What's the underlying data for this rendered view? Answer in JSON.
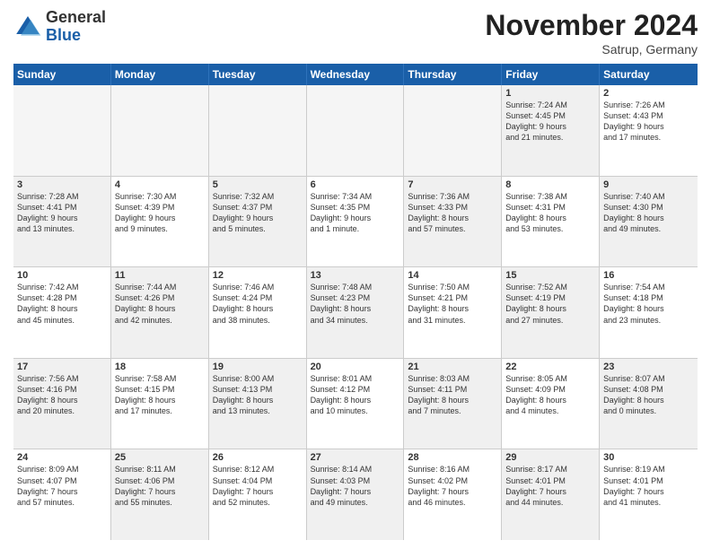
{
  "header": {
    "logo_general": "General",
    "logo_blue": "Blue",
    "month_title": "November 2024",
    "location": "Satrup, Germany"
  },
  "weekdays": [
    "Sunday",
    "Monday",
    "Tuesday",
    "Wednesday",
    "Thursday",
    "Friday",
    "Saturday"
  ],
  "rows": [
    [
      {
        "day": "",
        "info": "",
        "empty": true
      },
      {
        "day": "",
        "info": "",
        "empty": true
      },
      {
        "day": "",
        "info": "",
        "empty": true
      },
      {
        "day": "",
        "info": "",
        "empty": true
      },
      {
        "day": "",
        "info": "",
        "empty": true
      },
      {
        "day": "1",
        "info": "Sunrise: 7:24 AM\nSunset: 4:45 PM\nDaylight: 9 hours\nand 21 minutes.",
        "empty": false,
        "shaded": true
      },
      {
        "day": "2",
        "info": "Sunrise: 7:26 AM\nSunset: 4:43 PM\nDaylight: 9 hours\nand 17 minutes.",
        "empty": false,
        "shaded": false
      }
    ],
    [
      {
        "day": "3",
        "info": "Sunrise: 7:28 AM\nSunset: 4:41 PM\nDaylight: 9 hours\nand 13 minutes.",
        "empty": false,
        "shaded": true
      },
      {
        "day": "4",
        "info": "Sunrise: 7:30 AM\nSunset: 4:39 PM\nDaylight: 9 hours\nand 9 minutes.",
        "empty": false,
        "shaded": false
      },
      {
        "day": "5",
        "info": "Sunrise: 7:32 AM\nSunset: 4:37 PM\nDaylight: 9 hours\nand 5 minutes.",
        "empty": false,
        "shaded": true
      },
      {
        "day": "6",
        "info": "Sunrise: 7:34 AM\nSunset: 4:35 PM\nDaylight: 9 hours\nand 1 minute.",
        "empty": false,
        "shaded": false
      },
      {
        "day": "7",
        "info": "Sunrise: 7:36 AM\nSunset: 4:33 PM\nDaylight: 8 hours\nand 57 minutes.",
        "empty": false,
        "shaded": true
      },
      {
        "day": "8",
        "info": "Sunrise: 7:38 AM\nSunset: 4:31 PM\nDaylight: 8 hours\nand 53 minutes.",
        "empty": false,
        "shaded": false
      },
      {
        "day": "9",
        "info": "Sunrise: 7:40 AM\nSunset: 4:30 PM\nDaylight: 8 hours\nand 49 minutes.",
        "empty": false,
        "shaded": true
      }
    ],
    [
      {
        "day": "10",
        "info": "Sunrise: 7:42 AM\nSunset: 4:28 PM\nDaylight: 8 hours\nand 45 minutes.",
        "empty": false,
        "shaded": false
      },
      {
        "day": "11",
        "info": "Sunrise: 7:44 AM\nSunset: 4:26 PM\nDaylight: 8 hours\nand 42 minutes.",
        "empty": false,
        "shaded": true
      },
      {
        "day": "12",
        "info": "Sunrise: 7:46 AM\nSunset: 4:24 PM\nDaylight: 8 hours\nand 38 minutes.",
        "empty": false,
        "shaded": false
      },
      {
        "day": "13",
        "info": "Sunrise: 7:48 AM\nSunset: 4:23 PM\nDaylight: 8 hours\nand 34 minutes.",
        "empty": false,
        "shaded": true
      },
      {
        "day": "14",
        "info": "Sunrise: 7:50 AM\nSunset: 4:21 PM\nDaylight: 8 hours\nand 31 minutes.",
        "empty": false,
        "shaded": false
      },
      {
        "day": "15",
        "info": "Sunrise: 7:52 AM\nSunset: 4:19 PM\nDaylight: 8 hours\nand 27 minutes.",
        "empty": false,
        "shaded": true
      },
      {
        "day": "16",
        "info": "Sunrise: 7:54 AM\nSunset: 4:18 PM\nDaylight: 8 hours\nand 23 minutes.",
        "empty": false,
        "shaded": false
      }
    ],
    [
      {
        "day": "17",
        "info": "Sunrise: 7:56 AM\nSunset: 4:16 PM\nDaylight: 8 hours\nand 20 minutes.",
        "empty": false,
        "shaded": true
      },
      {
        "day": "18",
        "info": "Sunrise: 7:58 AM\nSunset: 4:15 PM\nDaylight: 8 hours\nand 17 minutes.",
        "empty": false,
        "shaded": false
      },
      {
        "day": "19",
        "info": "Sunrise: 8:00 AM\nSunset: 4:13 PM\nDaylight: 8 hours\nand 13 minutes.",
        "empty": false,
        "shaded": true
      },
      {
        "day": "20",
        "info": "Sunrise: 8:01 AM\nSunset: 4:12 PM\nDaylight: 8 hours\nand 10 minutes.",
        "empty": false,
        "shaded": false
      },
      {
        "day": "21",
        "info": "Sunrise: 8:03 AM\nSunset: 4:11 PM\nDaylight: 8 hours\nand 7 minutes.",
        "empty": false,
        "shaded": true
      },
      {
        "day": "22",
        "info": "Sunrise: 8:05 AM\nSunset: 4:09 PM\nDaylight: 8 hours\nand 4 minutes.",
        "empty": false,
        "shaded": false
      },
      {
        "day": "23",
        "info": "Sunrise: 8:07 AM\nSunset: 4:08 PM\nDaylight: 8 hours\nand 0 minutes.",
        "empty": false,
        "shaded": true
      }
    ],
    [
      {
        "day": "24",
        "info": "Sunrise: 8:09 AM\nSunset: 4:07 PM\nDaylight: 7 hours\nand 57 minutes.",
        "empty": false,
        "shaded": false
      },
      {
        "day": "25",
        "info": "Sunrise: 8:11 AM\nSunset: 4:06 PM\nDaylight: 7 hours\nand 55 minutes.",
        "empty": false,
        "shaded": true
      },
      {
        "day": "26",
        "info": "Sunrise: 8:12 AM\nSunset: 4:04 PM\nDaylight: 7 hours\nand 52 minutes.",
        "empty": false,
        "shaded": false
      },
      {
        "day": "27",
        "info": "Sunrise: 8:14 AM\nSunset: 4:03 PM\nDaylight: 7 hours\nand 49 minutes.",
        "empty": false,
        "shaded": true
      },
      {
        "day": "28",
        "info": "Sunrise: 8:16 AM\nSunset: 4:02 PM\nDaylight: 7 hours\nand 46 minutes.",
        "empty": false,
        "shaded": false
      },
      {
        "day": "29",
        "info": "Sunrise: 8:17 AM\nSunset: 4:01 PM\nDaylight: 7 hours\nand 44 minutes.",
        "empty": false,
        "shaded": true
      },
      {
        "day": "30",
        "info": "Sunrise: 8:19 AM\nSunset: 4:01 PM\nDaylight: 7 hours\nand 41 minutes.",
        "empty": false,
        "shaded": false
      }
    ]
  ]
}
